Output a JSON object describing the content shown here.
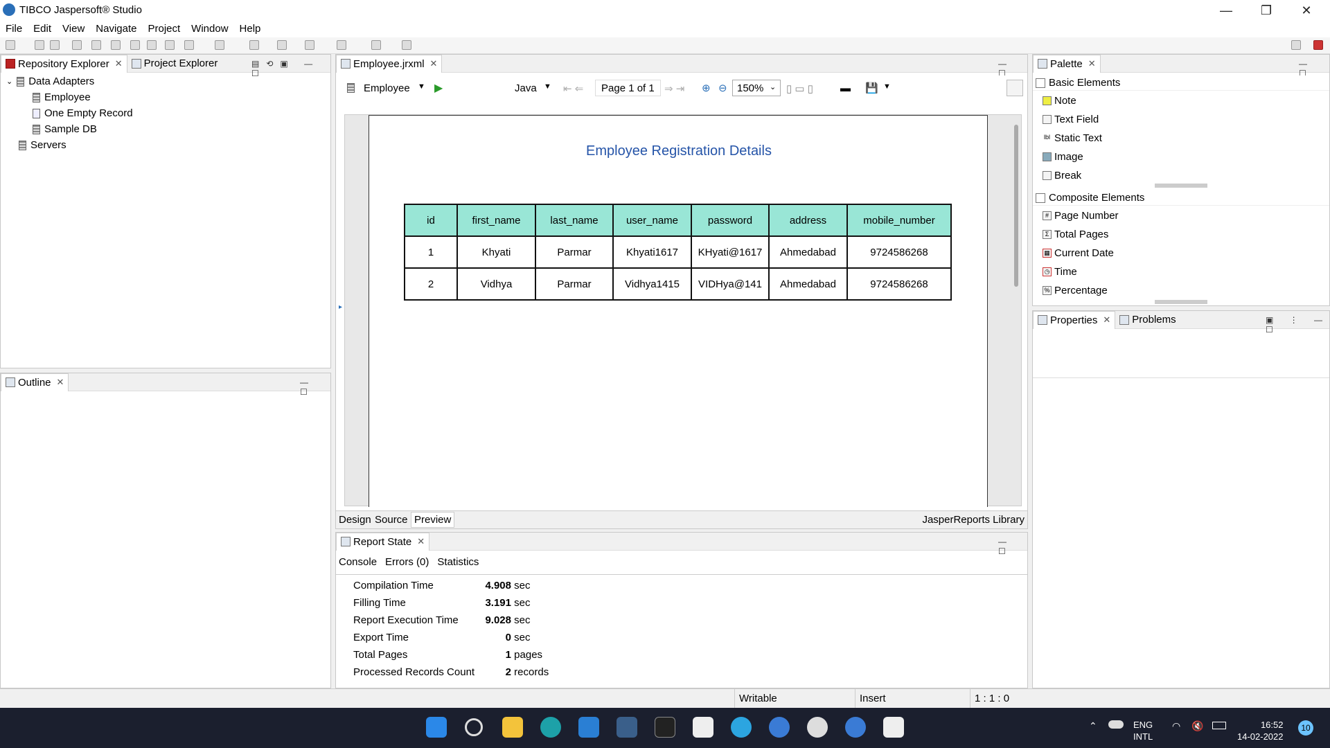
{
  "window": {
    "title": "TIBCO Jaspersoft® Studio"
  },
  "menu": [
    "File",
    "Edit",
    "View",
    "Navigate",
    "Project",
    "Window",
    "Help"
  ],
  "left_panel": {
    "tabs": [
      "Repository Explorer",
      "Project Explorer"
    ],
    "tree": {
      "root": "Data Adapters",
      "children": [
        "Employee",
        "One Empty Record",
        "Sample DB"
      ],
      "servers": "Servers"
    }
  },
  "outline": {
    "tab": "Outline"
  },
  "editor": {
    "tab": "Employee.jrxml",
    "adapter": "Employee",
    "language": "Java",
    "page_label": "Page 1 of 1",
    "zoom": "150%",
    "bottom_tabs": [
      "Design",
      "Source",
      "Preview"
    ],
    "library": "JasperReports Library"
  },
  "report": {
    "title": "Employee Registration Details",
    "columns": [
      "id",
      "first_name",
      "last_name",
      "user_name",
      "password",
      "address",
      "mobile_number"
    ],
    "rows": [
      [
        "1",
        "Khyati",
        "Parmar",
        "Khyati1617",
        "KHyati@1617",
        "Ahmedabad",
        "9724586268"
      ],
      [
        "2",
        "Vidhya",
        "Parmar",
        "Vidhya1415",
        "VIDHya@141",
        "Ahmedabad",
        "9724586268"
      ]
    ]
  },
  "palette": {
    "tab": "Palette",
    "basic_title": "Basic Elements",
    "basic": [
      "Note",
      "Text Field",
      "Static Text",
      "Image",
      "Break"
    ],
    "composite_title": "Composite Elements",
    "composite": [
      "Page Number",
      "Total Pages",
      "Current Date",
      "Time",
      "Percentage"
    ]
  },
  "properties": {
    "tabs": [
      "Properties",
      "Problems"
    ]
  },
  "report_state": {
    "tab": "Report State",
    "subtabs": [
      "Console",
      "Errors (0)",
      "Statistics"
    ],
    "stats": [
      {
        "label": "Compilation Time",
        "value": "4.908",
        "unit": "sec"
      },
      {
        "label": "Filling Time",
        "value": "3.191",
        "unit": "sec"
      },
      {
        "label": "Report Execution Time",
        "value": "9.028",
        "unit": "sec"
      },
      {
        "label": "Export Time",
        "value": "0",
        "unit": "sec"
      },
      {
        "label": "Total Pages",
        "value": "1",
        "unit": "pages"
      },
      {
        "label": "Processed Records Count",
        "value": "2",
        "unit": "records"
      }
    ]
  },
  "statusbar": {
    "mode": "Writable",
    "insert": "Insert",
    "position": "1 : 1 : 0"
  },
  "taskbar": {
    "lang1": "ENG",
    "lang2": "INTL",
    "time": "16:52",
    "date": "14-02-2022",
    "badge": "10"
  }
}
